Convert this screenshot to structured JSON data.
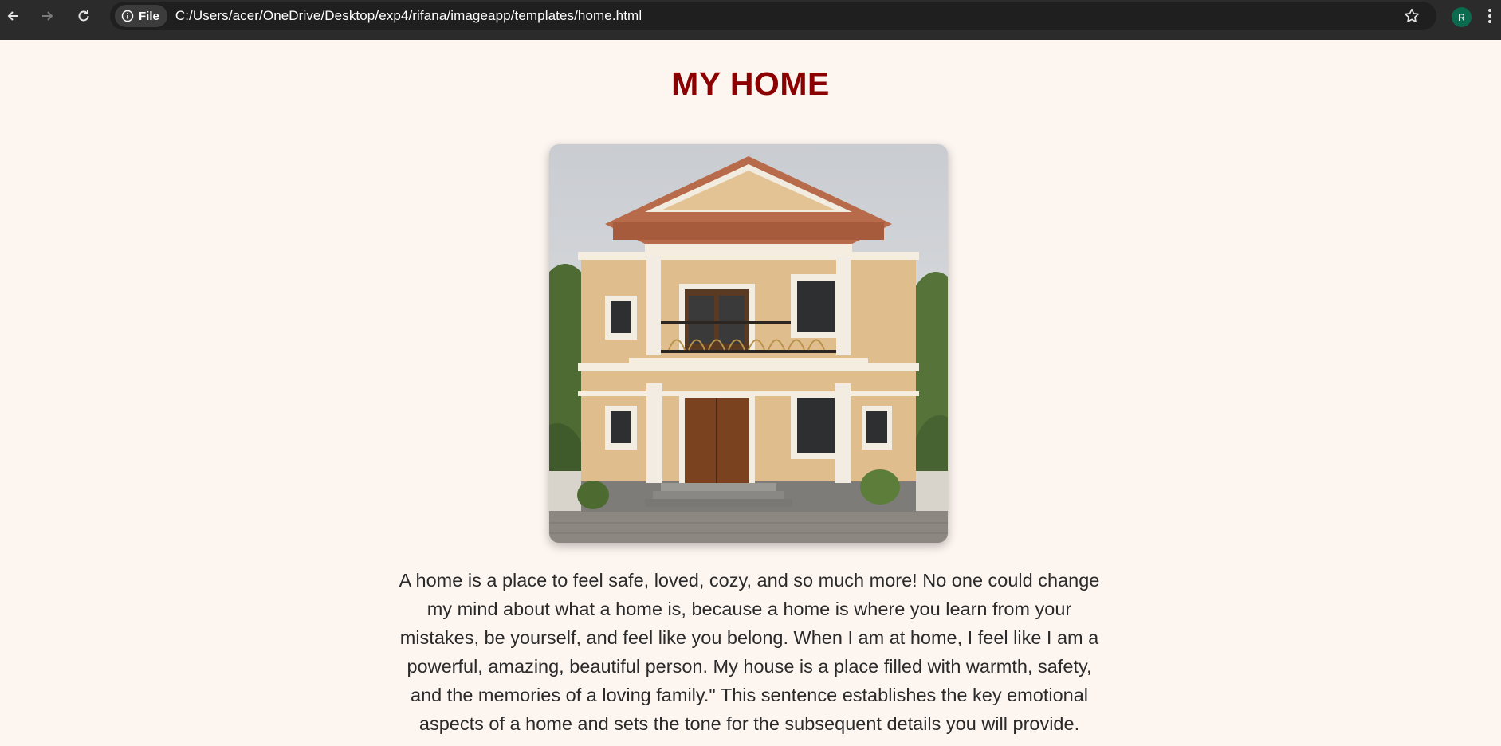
{
  "browser": {
    "file_chip_label": "File",
    "url": "C:/Users/acer/OneDrive/Desktop/exp4/rifana/imageapp/templates/home.html",
    "profile_initial": "R",
    "icons": [
      "back-arrow-icon",
      "forward-arrow-icon",
      "reload-icon",
      "info-icon",
      "star-icon",
      "kebab-menu-icon"
    ]
  },
  "page": {
    "title": "MY HOME",
    "description": "A home is a place to feel safe, loved, cozy, and so much more! No one could change my mind about what a home is, because a home is where you learn from your mistakes, be yourself, and feel like you belong. When I am at home, I feel like I am a powerful, amazing, beautiful person. My house is a place filled with warmth, safety, and the memories of a loving family.\" This sentence establishes the key emotional aspects of a home and sets the tone for the subsequent details you will provide."
  },
  "colors": {
    "page_background": "#fdf5f0",
    "title": "#8b0000",
    "chrome": "#2b2b2b",
    "avatar": "#0b6b4f"
  }
}
